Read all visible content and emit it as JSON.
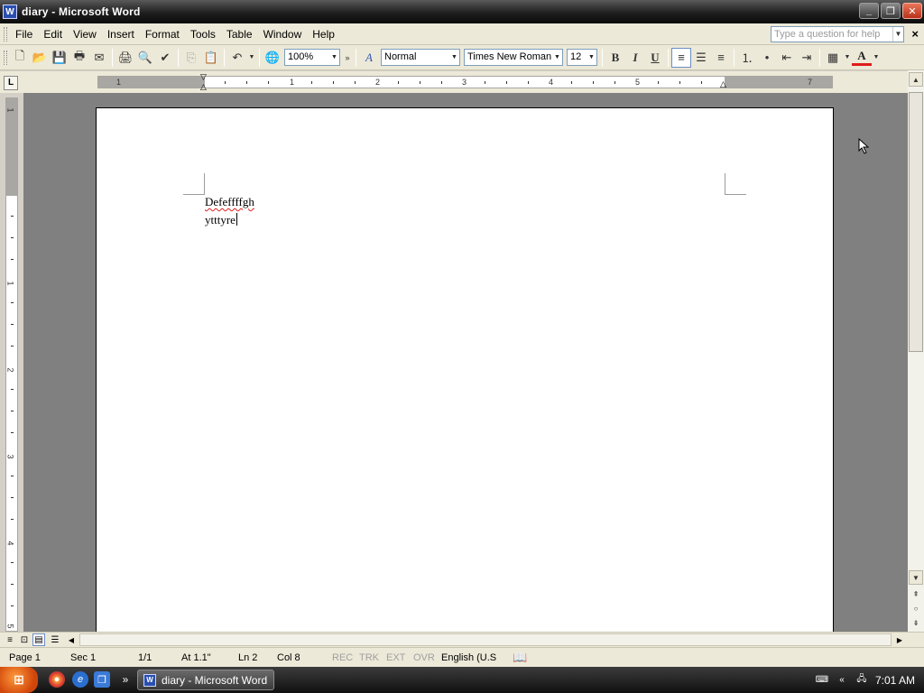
{
  "window": {
    "title": "diary - Microsoft Word",
    "app_icon": "word-icon",
    "minimize_icon": "minimize-icon",
    "restore_icon": "restore-icon",
    "close_icon": "close-icon"
  },
  "menubar": {
    "items": [
      "File",
      "Edit",
      "View",
      "Insert",
      "Format",
      "Tools",
      "Table",
      "Window",
      "Help"
    ],
    "help_placeholder": "Type a question for help"
  },
  "toolbar": {
    "zoom": "100%",
    "style": "Normal",
    "font": "Times New Roman",
    "size": "12",
    "bold": "B",
    "italic": "I",
    "underline": "U",
    "font_color": "#e01b1b"
  },
  "ruler": {
    "numbers": [
      "1",
      "1",
      "2",
      "3",
      "4",
      "5",
      "7"
    ],
    "vnumbers": [
      "1",
      "1",
      "2",
      "3",
      "4",
      "5"
    ],
    "tab_selector": "L"
  },
  "document": {
    "line1": "Defeffffgh",
    "line2": "ytttyre"
  },
  "statusbar": {
    "page": "Page  1",
    "sec": "Sec  1",
    "pages": "1/1",
    "at": "At  1.1\"",
    "ln": "Ln  2",
    "col": "Col  8",
    "rec": "REC",
    "trk": "TRK",
    "ext": "EXT",
    "ovr": "OVR",
    "language": "English (U.S"
  },
  "taskbar": {
    "task_label": "diary - Microsoft Word",
    "clock": "7:01 AM"
  }
}
